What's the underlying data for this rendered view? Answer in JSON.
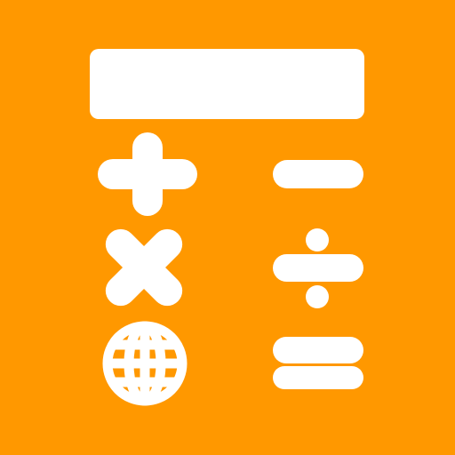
{
  "icon": {
    "description_name": "calculator-app-icon",
    "background_color": "#FF9800",
    "glyph_color": "#FFFFFF",
    "display": {
      "icon": "display-screen-icon"
    },
    "keys": [
      {
        "icon": "plus-icon"
      },
      {
        "icon": "minus-icon"
      },
      {
        "icon": "multiply-icon"
      },
      {
        "icon": "divide-icon"
      },
      {
        "icon": "globe-icon"
      },
      {
        "icon": "equals-icon"
      }
    ]
  }
}
